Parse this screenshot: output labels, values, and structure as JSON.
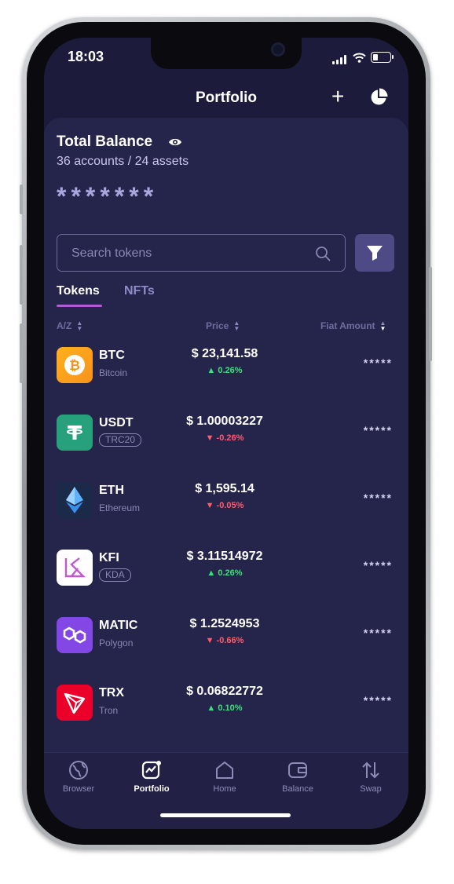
{
  "status": {
    "time": "18:03"
  },
  "header": {
    "title": "Portfolio",
    "add_icon": "plus-icon",
    "chart_icon": "pie-chart-icon"
  },
  "balance": {
    "label": "Total Balance",
    "summary": "36 accounts / 24 assets",
    "masked_value": "*******"
  },
  "search": {
    "placeholder": "Search tokens"
  },
  "tabs": [
    {
      "label": "Tokens",
      "active": true
    },
    {
      "label": "NFTs",
      "active": false
    }
  ],
  "columns": {
    "name": "A/Z",
    "price": "Price",
    "fiat": "Fiat Amount"
  },
  "tokens": [
    {
      "symbol": "BTC",
      "subtitle": "Bitcoin",
      "price": "$ 23,141.58",
      "change": "▲ 0.26%",
      "direction": "up",
      "fiat": "*****",
      "color": "#F7931A"
    },
    {
      "symbol": "USDT",
      "subtitle": "TRC20",
      "price": "$ 1.00003227",
      "change": "▼ -0.26%",
      "direction": "down",
      "fiat": "*****",
      "color": "#26A17B"
    },
    {
      "symbol": "ETH",
      "subtitle": "Ethereum",
      "price": "$ 1,595.14",
      "change": "▼ -0.05%",
      "direction": "down",
      "fiat": "*****",
      "color": "#1B2A48"
    },
    {
      "symbol": "KFI",
      "subtitle": "KDA",
      "price": "$ 3.11514972",
      "change": "▲ 0.26%",
      "direction": "up",
      "fiat": "*****",
      "color": "#FFFFFF"
    },
    {
      "symbol": "MATIC",
      "subtitle": "Polygon",
      "price": "$ 1.2524953",
      "change": "▼ -0.66%",
      "direction": "down",
      "fiat": "*****",
      "color": "#8247E5"
    },
    {
      "symbol": "TRX",
      "subtitle": "Tron",
      "price": "$ 0.06822772",
      "change": "▲ 0.10%",
      "direction": "up",
      "fiat": "*****",
      "color": "#EB0029"
    }
  ],
  "nav": [
    {
      "label": "Browser",
      "icon": "globe-icon",
      "active": false
    },
    {
      "label": "Portfolio",
      "icon": "portfolio-chart-icon",
      "active": true
    },
    {
      "label": "Home",
      "icon": "home-icon",
      "active": false
    },
    {
      "label": "Balance",
      "icon": "wallet-icon",
      "active": false
    },
    {
      "label": "Swap",
      "icon": "swap-icon",
      "active": false
    }
  ]
}
